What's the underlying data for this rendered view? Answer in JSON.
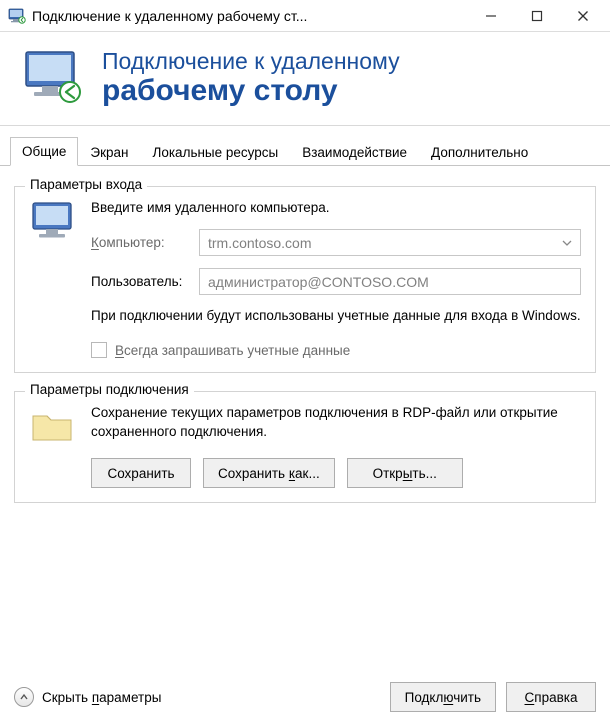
{
  "window": {
    "title": "Подключение к удаленному рабочему ст..."
  },
  "banner": {
    "line1": "Подключение к удаленному",
    "line2": "рабочему столу"
  },
  "tabs": {
    "items": [
      {
        "label": "Общие",
        "active": true
      },
      {
        "label": "Экран",
        "active": false
      },
      {
        "label": "Локальные ресурсы",
        "active": false
      },
      {
        "label": "Взаимодействие",
        "active": false
      },
      {
        "label": "Дополнительно",
        "active": false
      }
    ]
  },
  "login": {
    "group_title": "Параметры входа",
    "intro": "Введите имя удаленного компьютера.",
    "computer_label": "Компьютер:",
    "computer_value": "trm.contoso.com",
    "user_label": "Пользователь:",
    "user_value": "администратор@CONTOSO.COM",
    "note": "При подключении будут использованы учетные данные для входа в Windows.",
    "checkbox_label": "Всегда запрашивать учетные данные"
  },
  "connection": {
    "group_title": "Параметры подключения",
    "desc": "Сохранение текущих параметров подключения в RDP-файл или открытие сохраненного подключения.",
    "save": "Сохранить",
    "save_as": "Сохранить как...",
    "open": "Открыть..."
  },
  "footer": {
    "toggle": "Скрыть параметры",
    "connect": "Подключить",
    "help": "Справка"
  }
}
